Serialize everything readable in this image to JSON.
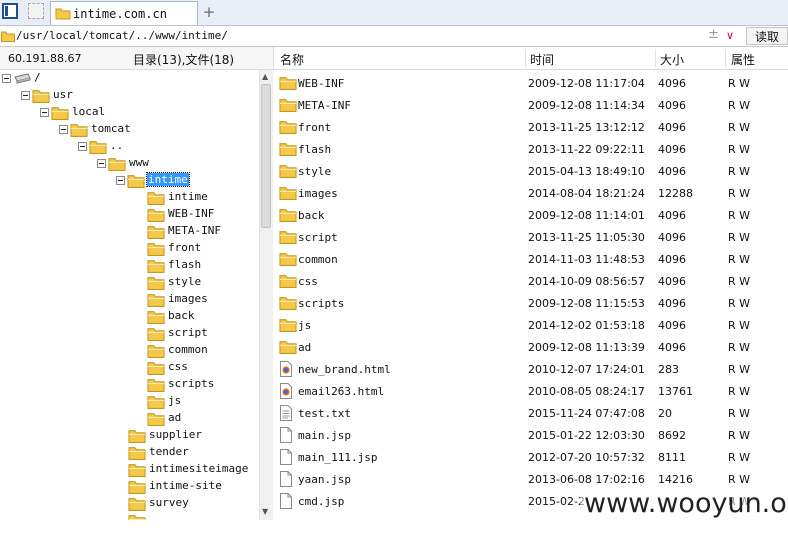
{
  "tabbar": {
    "tab_title": "intime.com.cn",
    "new_tab_label": "+"
  },
  "address": {
    "path": "/usr/local/tomcat/../www/intime/",
    "plus_glyph": "±",
    "dropdown_glyph": "∨",
    "read_button": "读取"
  },
  "left_header": {
    "ip": "60.191.88.67",
    "counts": "目录(13),文件(18)"
  },
  "tree": [
    {
      "label": "/",
      "indent": 0,
      "icon": "drive-icon",
      "box": true
    },
    {
      "label": "usr",
      "indent": 1,
      "icon": "folder-icon",
      "box": true
    },
    {
      "label": "local",
      "indent": 2,
      "icon": "folder-icon",
      "box": true
    },
    {
      "label": "tomcat",
      "indent": 3,
      "icon": "folder-icon",
      "box": true
    },
    {
      "label": "..",
      "indent": 4,
      "icon": "folder-icon",
      "box": true
    },
    {
      "label": "www",
      "indent": 5,
      "icon": "folder-icon",
      "box": true
    },
    {
      "label": "intime",
      "indent": 6,
      "icon": "folder-icon",
      "box": true,
      "selected": true
    },
    {
      "label": "intime",
      "indent": 7,
      "icon": "folder-icon"
    },
    {
      "label": "WEB-INF",
      "indent": 7,
      "icon": "folder-icon"
    },
    {
      "label": "META-INF",
      "indent": 7,
      "icon": "folder-icon"
    },
    {
      "label": "front",
      "indent": 7,
      "icon": "folder-icon"
    },
    {
      "label": "flash",
      "indent": 7,
      "icon": "folder-icon"
    },
    {
      "label": "style",
      "indent": 7,
      "icon": "folder-icon"
    },
    {
      "label": "images",
      "indent": 7,
      "icon": "folder-icon"
    },
    {
      "label": "back",
      "indent": 7,
      "icon": "folder-icon"
    },
    {
      "label": "script",
      "indent": 7,
      "icon": "folder-icon"
    },
    {
      "label": "common",
      "indent": 7,
      "icon": "folder-icon"
    },
    {
      "label": "css",
      "indent": 7,
      "icon": "folder-icon"
    },
    {
      "label": "scripts",
      "indent": 7,
      "icon": "folder-icon"
    },
    {
      "label": "js",
      "indent": 7,
      "icon": "folder-icon"
    },
    {
      "label": "ad",
      "indent": 7,
      "icon": "folder-icon"
    },
    {
      "label": "supplier",
      "indent": 6,
      "icon": "folder-icon"
    },
    {
      "label": "tender",
      "indent": 6,
      "icon": "folder-icon"
    },
    {
      "label": "intimesiteimage",
      "indent": 6,
      "icon": "folder-icon"
    },
    {
      "label": "intime-site",
      "indent": 6,
      "icon": "folder-icon"
    },
    {
      "label": "survey",
      "indent": 6,
      "icon": "folder-icon"
    },
    {
      "label": "",
      "indent": 6,
      "icon": "folder-icon"
    }
  ],
  "columns": {
    "name": "名称",
    "time": "时间",
    "size": "大小",
    "attr": "属性"
  },
  "files": [
    {
      "name": "WEB-INF",
      "time": "2009-12-08 11:17:04",
      "size": "4096",
      "attr": "R W",
      "icon": "folder-icon"
    },
    {
      "name": "META-INF",
      "time": "2009-12-08 11:14:34",
      "size": "4096",
      "attr": "R W",
      "icon": "folder-icon"
    },
    {
      "name": "front",
      "time": "2013-11-25 13:12:12",
      "size": "4096",
      "attr": "R W",
      "icon": "folder-icon"
    },
    {
      "name": "flash",
      "time": "2013-11-22 09:22:11",
      "size": "4096",
      "attr": "R W",
      "icon": "folder-icon"
    },
    {
      "name": "style",
      "time": "2015-04-13 18:49:10",
      "size": "4096",
      "attr": "R W",
      "icon": "folder-icon"
    },
    {
      "name": "images",
      "time": "2014-08-04 18:21:24",
      "size": "12288",
      "attr": "R W",
      "icon": "folder-icon"
    },
    {
      "name": "back",
      "time": "2009-12-08 11:14:01",
      "size": "4096",
      "attr": "R W",
      "icon": "folder-icon"
    },
    {
      "name": "script",
      "time": "2013-11-25 11:05:30",
      "size": "4096",
      "attr": "R W",
      "icon": "folder-icon"
    },
    {
      "name": "common",
      "time": "2014-11-03 11:48:53",
      "size": "4096",
      "attr": "R W",
      "icon": "folder-icon"
    },
    {
      "name": "css",
      "time": "2014-10-09 08:56:57",
      "size": "4096",
      "attr": "R W",
      "icon": "folder-icon"
    },
    {
      "name": "scripts",
      "time": "2009-12-08 11:15:53",
      "size": "4096",
      "attr": "R W",
      "icon": "folder-icon"
    },
    {
      "name": "js",
      "time": "2014-12-02 01:53:18",
      "size": "4096",
      "attr": "R W",
      "icon": "folder-icon"
    },
    {
      "name": "ad",
      "time": "2009-12-08 11:13:39",
      "size": "4096",
      "attr": "R W",
      "icon": "folder-icon"
    },
    {
      "name": "new_brand.html",
      "time": "2010-12-07 17:24:01",
      "size": "283",
      "attr": "R W",
      "icon": "html-file-icon"
    },
    {
      "name": "email263.html",
      "time": "2010-08-05 08:24:17",
      "size": "13761",
      "attr": "R W",
      "icon": "html-file-icon"
    },
    {
      "name": "test.txt",
      "time": "2015-11-24 07:47:08",
      "size": "20",
      "attr": "R W",
      "icon": "text-file-icon"
    },
    {
      "name": "main.jsp",
      "time": "2015-01-22 12:03:30",
      "size": "8692",
      "attr": "R W",
      "icon": "file-icon"
    },
    {
      "name": "main_111.jsp",
      "time": "2012-07-20 10:57:32",
      "size": "8111",
      "attr": "R W",
      "icon": "file-icon"
    },
    {
      "name": "yaan.jsp",
      "time": "2013-06-08 17:02:16",
      "size": "14216",
      "attr": "R W",
      "icon": "file-icon"
    },
    {
      "name": "cmd.jsp",
      "time": "2015-02-2",
      "size": "",
      "attr": "R W",
      "icon": "file-icon"
    }
  ],
  "watermark": "www.wooyun.org",
  "colors": {
    "folder": "#f3c84b",
    "folder_border": "#c79a1e",
    "selection": "#3399ff",
    "tab_bar": "#e9eef6"
  }
}
